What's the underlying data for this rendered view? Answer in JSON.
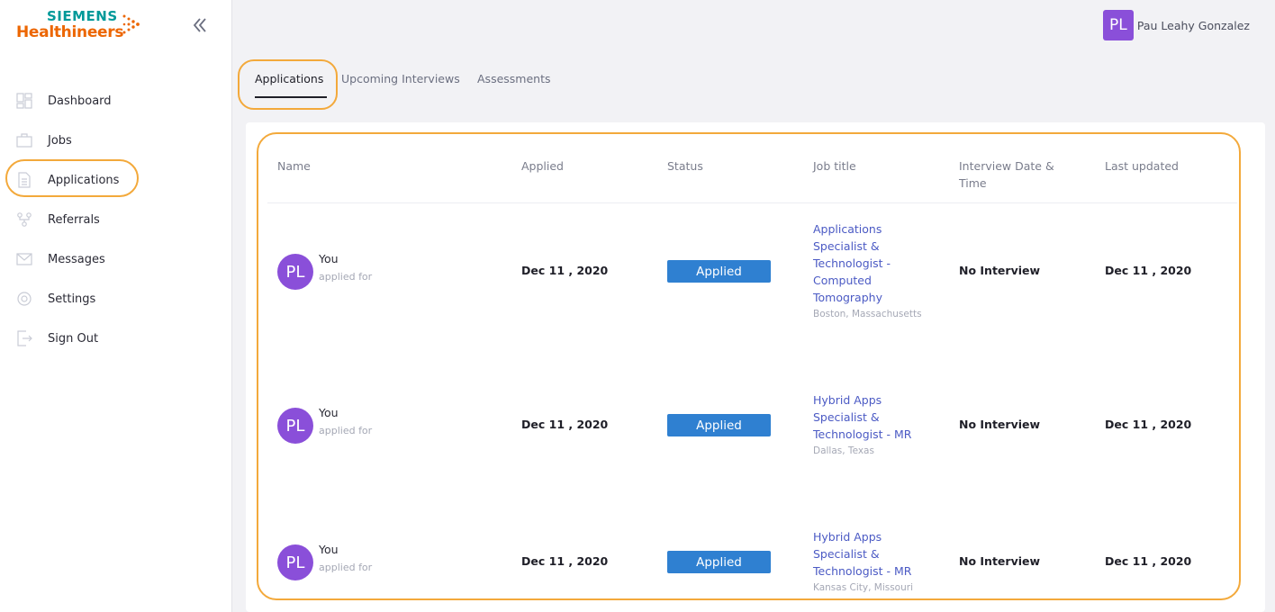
{
  "brand": {
    "name_top": "SIEMENS",
    "name_bottom": "Healthineers",
    "primary_color": "#009999",
    "accent_color": "#ec6602"
  },
  "sidebar": {
    "collapse_icon": "double-chevron-left-icon",
    "items": [
      {
        "label": "Dashboard",
        "icon": "dashboard-icon"
      },
      {
        "label": "Jobs",
        "icon": "briefcase-icon"
      },
      {
        "label": "Applications",
        "icon": "document-icon",
        "selected": true
      },
      {
        "label": "Referrals",
        "icon": "referrals-icon"
      },
      {
        "label": "Messages",
        "icon": "envelope-icon"
      },
      {
        "label": "Settings",
        "icon": "gear-icon"
      },
      {
        "label": "Sign Out",
        "icon": "sign-out-icon"
      }
    ]
  },
  "header": {
    "user_initials": "PL",
    "user_name": "Pau Leahy Gonzalez"
  },
  "tabs": [
    {
      "label": "Applications",
      "active": true
    },
    {
      "label": "Upcoming Interviews",
      "active": false
    },
    {
      "label": "Assessments",
      "active": false
    }
  ],
  "table": {
    "columns": [
      "Name",
      "Applied",
      "Status",
      "Job title",
      "Interview Date & Time",
      "Last updated"
    ],
    "rows": [
      {
        "initials": "PL",
        "name": "You",
        "subtext": "applied for",
        "applied": "Dec 11 , 2020",
        "status": "Applied",
        "job_title": "Applications Specialist & Technologist - Computed Tomography",
        "location": "Boston, Massachusetts",
        "interview": "No Interview",
        "last_updated": "Dec 11 , 2020"
      },
      {
        "initials": "PL",
        "name": "You",
        "subtext": "applied for",
        "applied": "Dec 11 , 2020",
        "status": "Applied",
        "job_title": "Hybrid Apps Specialist & Technologist - MR",
        "location": "Dallas, Texas",
        "interview": "No Interview",
        "last_updated": "Dec 11 , 2020"
      },
      {
        "initials": "PL",
        "name": "You",
        "subtext": "applied for",
        "applied": "Dec 11 , 2020",
        "status": "Applied",
        "job_title": "Hybrid Apps Specialist & Technologist - MR",
        "location": "Kansas City, Missouri",
        "interview": "No Interview",
        "last_updated": "Dec 11 , 2020"
      }
    ]
  },
  "colors": {
    "highlight": "#f3a93b",
    "status_badge": "#2f80d1",
    "avatar": "#8a4fd9",
    "link": "#4b5ac4"
  }
}
